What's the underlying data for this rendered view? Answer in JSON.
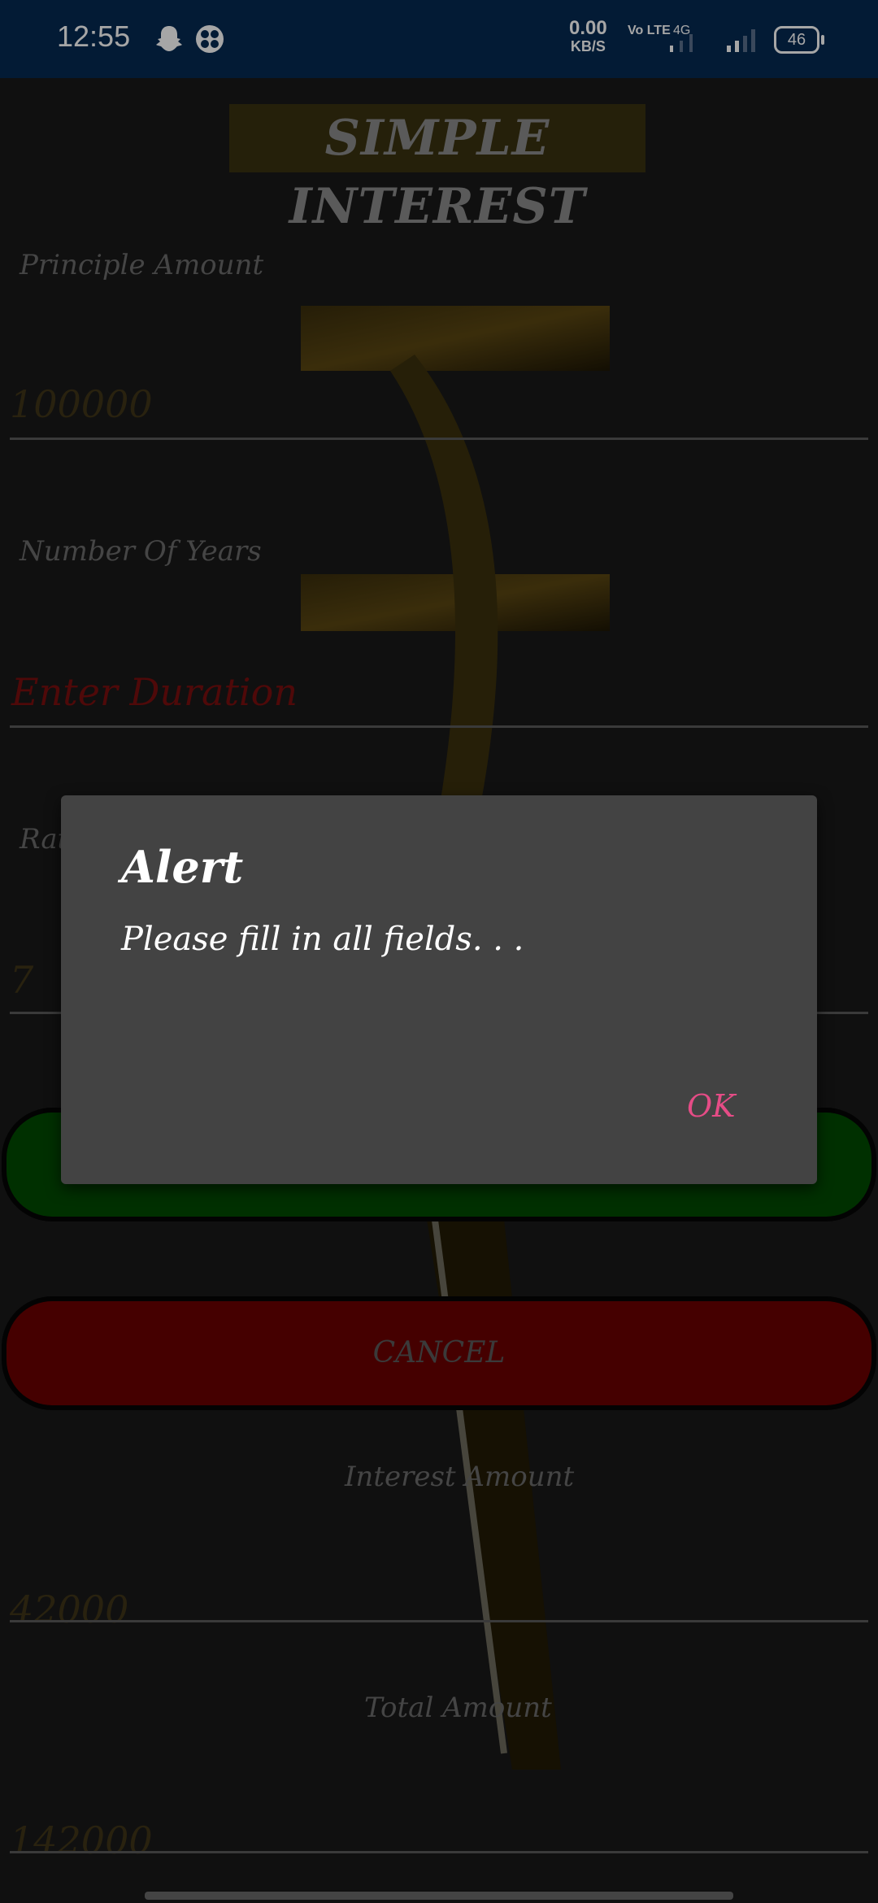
{
  "status_bar": {
    "time": "12:55",
    "net_speed": "0.00",
    "net_unit": "KB/S",
    "volte": "Vo LTE",
    "network": "4G",
    "battery": "46"
  },
  "app": {
    "title": "SIMPLE INTEREST",
    "principal_label": "Principle Amount",
    "principal_value": "100000",
    "years_label": "Number Of Years",
    "years_placeholder": "Enter Duration",
    "rate_label": "Rat",
    "rate_value": "7",
    "cancel_label": "CANCEL",
    "interest_label": "Interest Amount",
    "interest_value": "42000",
    "total_label": "Total Amount",
    "total_value": "142000"
  },
  "dialog": {
    "title": "Alert",
    "message": "Please fill in all fields. . .",
    "ok_label": "OK"
  },
  "colors": {
    "status_bar": "#062a52",
    "placeholder_red": "#7a0f0f",
    "calculate_green": "#014a01",
    "cancel_red": "#6b0000",
    "ok_accent": "#e54c86"
  }
}
